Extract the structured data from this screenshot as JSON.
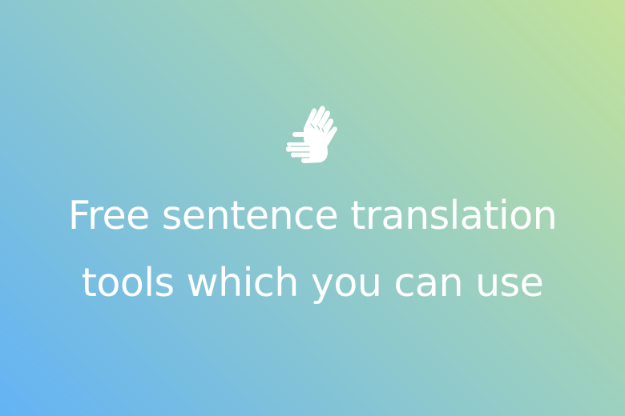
{
  "banner": {
    "icon": "sign-language-hands-icon",
    "gradient_colors": [
      "#63b3f5",
      "#8ec9cc",
      "#a8d6b4",
      "#c3e29a"
    ],
    "text_color": "#ffffff",
    "headline_lines": [
      "Free sentence translation",
      "tools which you can use"
    ]
  }
}
